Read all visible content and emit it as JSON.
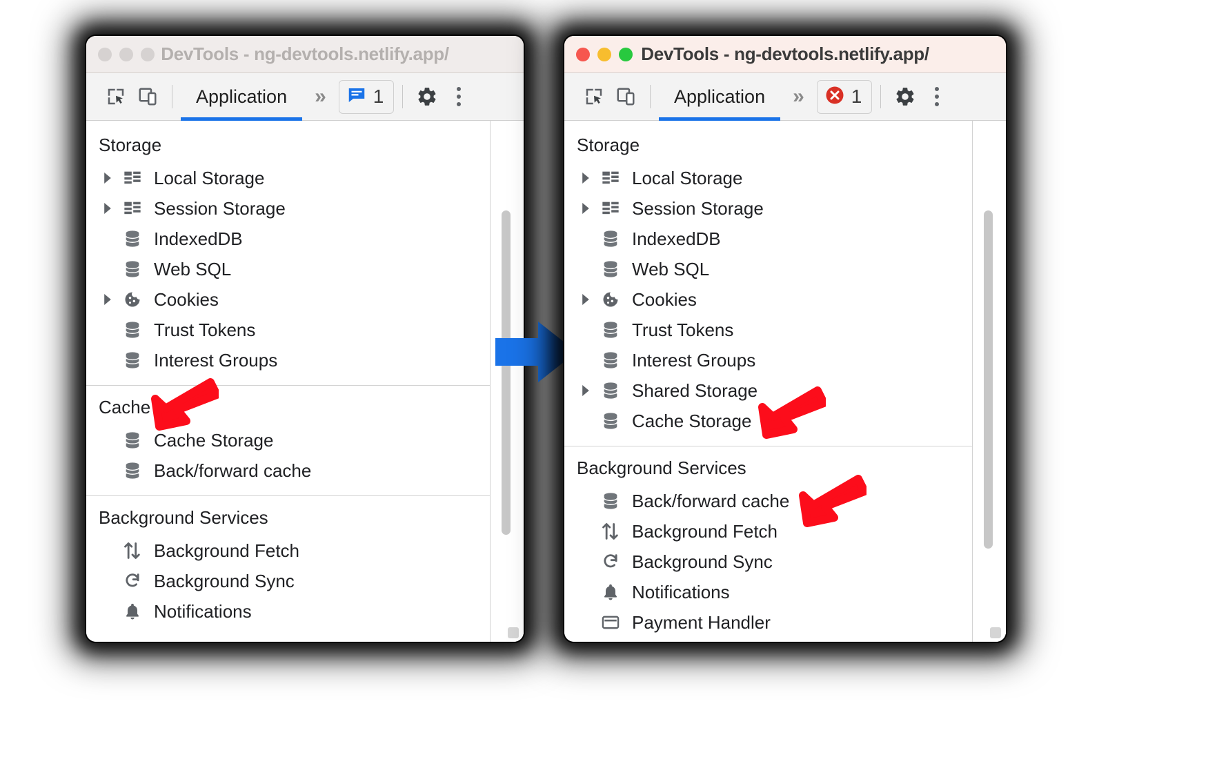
{
  "colors": {
    "accent_blue": "#1a73e8",
    "arrow_blue": "#1a73e8",
    "annotation_red": "#fc0d1b",
    "error_red": "#d93025",
    "icon_gray": "#5f6368",
    "text": "#202124",
    "title_active": "#3b3b3b",
    "title_inactive": "#b4b0ae",
    "titlebar_active_bg": "#fbeeea",
    "titlebar_inactive_bg": "#f0eceb"
  },
  "left_window": {
    "focused": false,
    "titlebar": {
      "title": "DevTools - ng-devtools.netlify.app/",
      "traffic_lights": [
        "close",
        "minimize",
        "zoom"
      ]
    },
    "toolbar": {
      "inspect_icon": "inspect-element-icon",
      "device_icon": "device-toolbar-icon",
      "tab_label": "Application",
      "more_panels": "»",
      "badge": {
        "type": "info",
        "icon": "message-icon",
        "count": "1"
      },
      "settings_icon": "gear-icon",
      "overflow_icon": "kebab-icon"
    },
    "tree": [
      {
        "section": "Storage",
        "items": [
          {
            "label": "Local Storage",
            "icon": "table-icon",
            "expandable": true
          },
          {
            "label": "Session Storage",
            "icon": "table-icon",
            "expandable": true
          },
          {
            "label": "IndexedDB",
            "icon": "database-icon",
            "expandable": false
          },
          {
            "label": "Web SQL",
            "icon": "database-icon",
            "expandable": false
          },
          {
            "label": "Cookies",
            "icon": "cookie-icon",
            "expandable": true
          },
          {
            "label": "Trust Tokens",
            "icon": "database-icon",
            "expandable": false
          },
          {
            "label": "Interest Groups",
            "icon": "database-icon",
            "expandable": false
          }
        ]
      },
      {
        "section": "Cache",
        "items": [
          {
            "label": "Cache Storage",
            "icon": "database-icon",
            "expandable": false
          },
          {
            "label": "Back/forward cache",
            "icon": "database-icon",
            "expandable": false
          }
        ]
      },
      {
        "section": "Background Services",
        "items": [
          {
            "label": "Background Fetch",
            "icon": "background-fetch-icon",
            "expandable": false
          },
          {
            "label": "Background Sync",
            "icon": "background-sync-icon",
            "expandable": false
          },
          {
            "label": "Notifications",
            "icon": "bell-icon",
            "expandable": false
          }
        ]
      }
    ]
  },
  "right_window": {
    "focused": true,
    "titlebar": {
      "title": "DevTools - ng-devtools.netlify.app/",
      "traffic_lights": [
        "close",
        "minimize",
        "zoom"
      ]
    },
    "toolbar": {
      "inspect_icon": "inspect-element-icon",
      "device_icon": "device-toolbar-icon",
      "tab_label": "Application",
      "more_panels": "»",
      "badge": {
        "type": "error",
        "icon": "error-icon",
        "count": "1"
      },
      "settings_icon": "gear-icon",
      "overflow_icon": "kebab-icon"
    },
    "tree": [
      {
        "section": "Storage",
        "items": [
          {
            "label": "Local Storage",
            "icon": "table-icon",
            "expandable": true
          },
          {
            "label": "Session Storage",
            "icon": "table-icon",
            "expandable": true
          },
          {
            "label": "IndexedDB",
            "icon": "database-icon",
            "expandable": false
          },
          {
            "label": "Web SQL",
            "icon": "database-icon",
            "expandable": false
          },
          {
            "label": "Cookies",
            "icon": "cookie-icon",
            "expandable": true
          },
          {
            "label": "Trust Tokens",
            "icon": "database-icon",
            "expandable": false
          },
          {
            "label": "Interest Groups",
            "icon": "database-icon",
            "expandable": false
          },
          {
            "label": "Shared Storage",
            "icon": "database-icon",
            "expandable": true
          },
          {
            "label": "Cache Storage",
            "icon": "database-icon",
            "expandable": false
          }
        ]
      },
      {
        "section": "Background Services",
        "items": [
          {
            "label": "Back/forward cache",
            "icon": "database-icon",
            "expandable": false
          },
          {
            "label": "Background Fetch",
            "icon": "background-fetch-icon",
            "expandable": false
          },
          {
            "label": "Background Sync",
            "icon": "background-sync-icon",
            "expandable": false
          },
          {
            "label": "Notifications",
            "icon": "bell-icon",
            "expandable": false
          },
          {
            "label": "Payment Handler",
            "icon": "payment-handler-icon",
            "expandable": false
          }
        ]
      }
    ]
  },
  "annotations": {
    "transition_arrow": "blue-right-arrow",
    "callouts": [
      {
        "name": "cache-section-callout",
        "target": "Cache"
      },
      {
        "name": "cache-storage-callout",
        "target": "Cache Storage"
      },
      {
        "name": "back-forward-cache-callout",
        "target": "Back/forward cache"
      }
    ]
  }
}
